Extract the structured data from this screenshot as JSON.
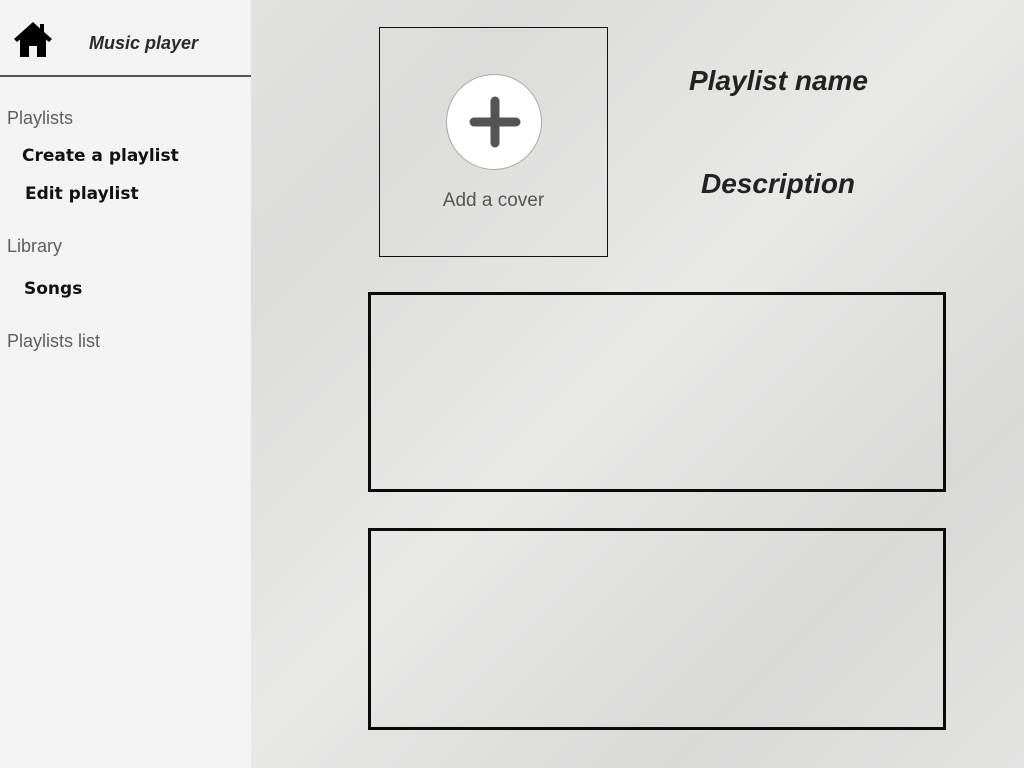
{
  "app": {
    "title": "Music player",
    "home_icon": "home-icon"
  },
  "sidebar": {
    "sections": [
      {
        "label": "Playlists",
        "items": [
          {
            "label": "Create a playlist"
          },
          {
            "label": "Edit playlist"
          }
        ]
      },
      {
        "label": "Library",
        "items": [
          {
            "label": "Songs"
          }
        ]
      },
      {
        "label": "Playlists list",
        "items": []
      }
    ]
  },
  "main": {
    "cover": {
      "label": "Add a cover",
      "icon": "plus-icon"
    },
    "playlist_name": "Playlist name",
    "description": "Description"
  }
}
